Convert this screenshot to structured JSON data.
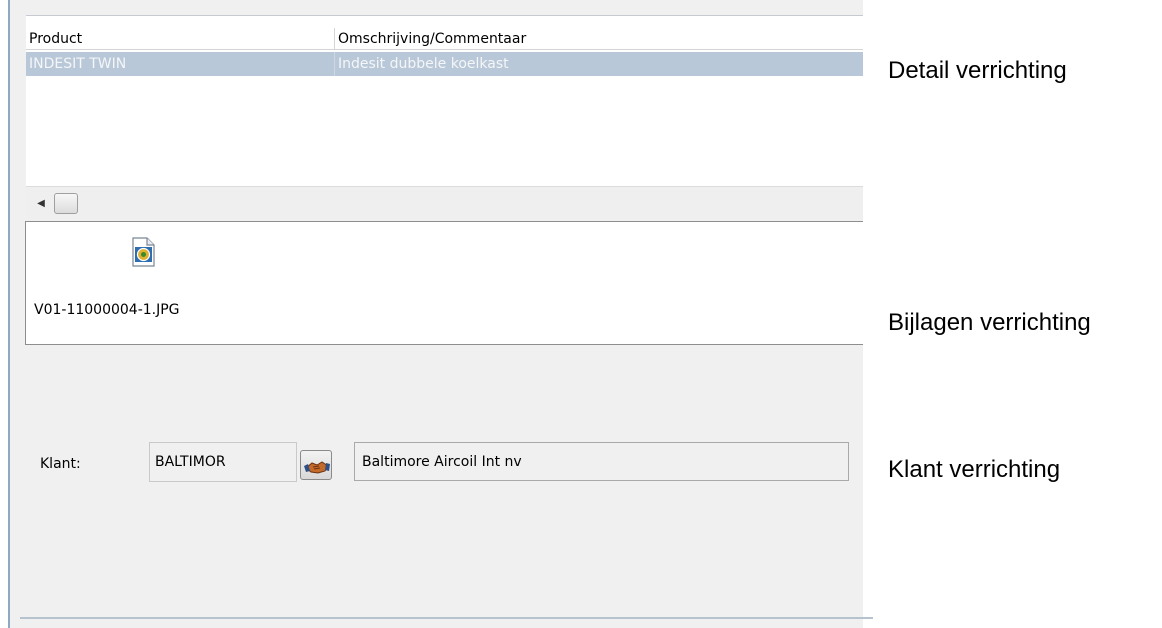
{
  "grid": {
    "columns": [
      "Product",
      "Omschrijving/Commentaar"
    ],
    "rows": [
      {
        "product": "INDESIT TWIN",
        "description": "Indesit dubbele koelkast"
      }
    ]
  },
  "attachments": {
    "files": [
      {
        "name": "V01-11000004-1.JPG",
        "icon": "image-file-icon"
      }
    ]
  },
  "customer": {
    "label": "Klant:",
    "code": "BALTIMOR",
    "name": "Baltimore Aircoil Int nv",
    "lookup_icon": "handshake-icon"
  },
  "annotations": {
    "detail": "Detail verrichting",
    "attachments": "Bijlagen verrichting",
    "customer": "Klant verrichting"
  },
  "colors": {
    "selected_row": "#b9c8d8",
    "panel_bg": "#f0f0f0"
  }
}
